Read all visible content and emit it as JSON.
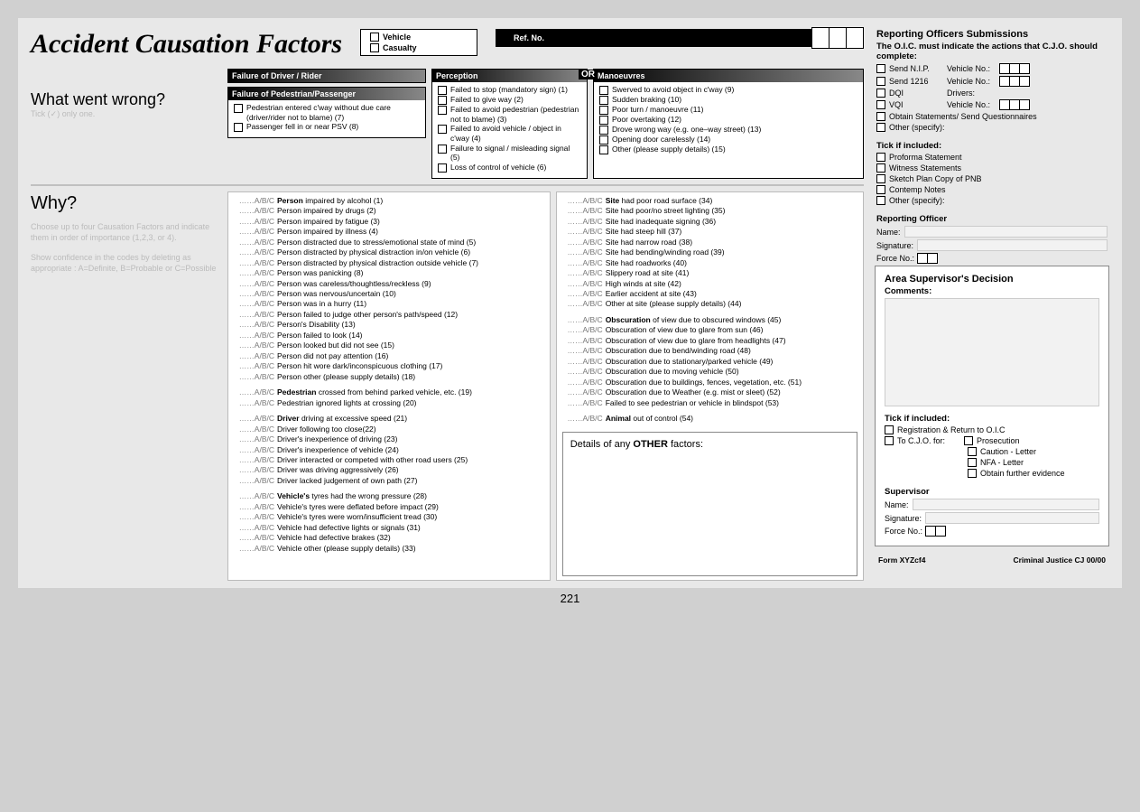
{
  "title": "Accident Causation Factors",
  "vehicle_label": "Vehicle",
  "casualty_label": "Casualty",
  "ref_label": "Ref. No.",
  "page_number": "221",
  "wwwrong": {
    "heading": "What went wrong?",
    "sub": "Tick (✓) only one.",
    "driver_hdr": "Failure of Driver / Rider",
    "ped_hdr": "Failure of Pedestrian/Passenger",
    "ped_items": [
      "Pedestrian entered c'way without due care (driver/rider not to blame) (7)",
      "Passenger fell in or near PSV (8)"
    ],
    "perc_hdr": "Perception",
    "perc_items": [
      "Failed to stop (mandatory sign) (1)",
      "Failed to give way (2)",
      "Failed to avoid pedestrian (pedestrian not to blame) (3)",
      "Failed to avoid vehicle / object in c'way (4)",
      "Failure to signal / misleading signal (5)",
      "Loss of control of vehicle (6)"
    ],
    "or_label": "OR",
    "man_hdr": "Manoeuvres",
    "man_items": [
      "Swerved to avoid object in c'way (9)",
      "Sudden braking (10)",
      "Poor turn / manoeuvre (11)",
      "Poor overtaking (12)",
      "Drove wrong way (e.g. one–way street) (13)",
      "Opening door carelessly (14)",
      "Other (please supply details) (15)"
    ]
  },
  "why": {
    "heading": "Why?",
    "side_p1": "Choose up to four Causation Factors and indicate them in order of importance (1,2,3, or 4).",
    "side_p2": "Show confidence in the codes by deleting as appropriate : A=Definite, B=Probable or C=Possible",
    "abc": "……A/B/C",
    "left_items": [
      {
        "t": "Person impaired by alcohol (1)",
        "b": true
      },
      {
        "t": "Person impaired by drugs (2)"
      },
      {
        "t": "Person impaired by fatigue (3)"
      },
      {
        "t": "Person impaired by illness (4)"
      },
      {
        "t": "Person distracted due to stress/emotional state of mind (5)"
      },
      {
        "t": "Person distracted by physical distraction in/on vehicle (6)"
      },
      {
        "t": "Person distracted by physical distraction outside vehicle (7)"
      },
      {
        "t": "Person was panicking (8)"
      },
      {
        "t": "Person was careless/thoughtless/reckless (9)"
      },
      {
        "t": "Person was nervous/uncertain (10)"
      },
      {
        "t": "Person was in a hurry (11)"
      },
      {
        "t": "Person failed to judge other person's path/speed (12)"
      },
      {
        "t": "Person's Disability (13)"
      },
      {
        "t": "Person failed to look (14)"
      },
      {
        "t": "Person looked but did not see (15)"
      },
      {
        "t": "Person did not pay attention (16)"
      },
      {
        "t": "Person hit wore dark/inconspicuous clothing (17)"
      },
      {
        "t": "Person other (please supply details) (18)"
      },
      {
        "gap": true
      },
      {
        "t": "Pedestrian crossed from behind parked vehicle, etc. (19)",
        "b": true
      },
      {
        "t": "Pedestrian ignored lights at crossing (20)"
      },
      {
        "gap": true
      },
      {
        "t": "Driver driving at excessive speed (21)",
        "b": true
      },
      {
        "t": "Driver following too close(22)"
      },
      {
        "t": "Driver's  inexperience of driving (23)"
      },
      {
        "t": "Driver's  inexperience of vehicle (24)"
      },
      {
        "t": "Driver interacted or competed with other road users (25)"
      },
      {
        "t": "Driver was driving aggressively (26)"
      },
      {
        "t": "Driver lacked judgement of own path (27)"
      },
      {
        "gap": true
      },
      {
        "t": "Vehicle's tyres had the wrong pressure (28)",
        "b": true
      },
      {
        "t": "Vehicle's tyres were deflated before impact (29)"
      },
      {
        "t": "Vehicle's tyres were worn/insufficient tread (30)"
      },
      {
        "t": "Vehicle had defective lights or signals (31)"
      },
      {
        "t": "Vehicle had defective brakes (32)"
      },
      {
        "t": "Vehicle other (please supply details) (33)"
      }
    ],
    "right_items": [
      {
        "t": "Site had poor road surface (34)",
        "b": true
      },
      {
        "t": "Site had poor/no street lighting (35)"
      },
      {
        "t": "Site had inadequate signing (36)"
      },
      {
        "t": "Site had steep hill (37)"
      },
      {
        "t": "Site had narrow road (38)"
      },
      {
        "t": "Site had bending/winding road (39)"
      },
      {
        "t": "Site had roadworks (40)"
      },
      {
        "t": "Slippery road at site (41)"
      },
      {
        "t": "High winds at site (42)"
      },
      {
        "t": "Earlier accident at site (43)"
      },
      {
        "t": "Other at site (please supply details) (44)"
      },
      {
        "gap": true
      },
      {
        "t": "Obscuration of view due to obscured windows  (45)",
        "b": true
      },
      {
        "t": "Obscuration of view due to glare from sun (46)"
      },
      {
        "t": "Obscuration of view due to glare from headlights (47)"
      },
      {
        "t": "Obscuration due to bend/winding road (48)"
      },
      {
        "t": "Obscuration due to stationary/parked vehicle (49)"
      },
      {
        "t": "Obscuration due to moving vehicle (50)"
      },
      {
        "t": "Obscuration due to buildings, fences, vegetation, etc. (51)"
      },
      {
        "t": "Obscuration due to Weather (e.g. mist or sleet) (52)"
      },
      {
        "t": "Failed to see pedestrian or vehicle in blindspot (53)"
      },
      {
        "gap": true
      },
      {
        "t": "Animal out of control (54)",
        "b": true
      }
    ],
    "details_label": "Details of any OTHER factors:"
  },
  "right": {
    "submissions_hdr": "Reporting Officers Submissions",
    "submissions_sub": "The O.I.C. must indicate the actions that C.J.O. should complete:",
    "send_nip": "Send N.I.P.",
    "send_1216": "Send 1216",
    "vehicle_no": "Vehicle No.:",
    "dqi": "DQI",
    "drivers": "Drivers:",
    "vqi": "VQI",
    "obtain_stmt": "Obtain Statements/ Send Questionnaires",
    "other_spec": "Other (specify):",
    "tick_hdr": "Tick if included:",
    "tick_items": [
      "Proforma Statement",
      "Witness Statements",
      "Sketch Plan Copy of PNB",
      "Contemp Notes",
      "Other (specify):"
    ],
    "rep_off_hdr": "Reporting Officer",
    "name": "Name:",
    "signature": "Signature:",
    "force_no": "Force No.:",
    "area_hdr": "Area Supervisor's Decision",
    "comments": "Comments:",
    "tick2_items": {
      "reg": "Registration & Return to O.I.C",
      "tocjo": "To C.J.O. for:",
      "pros": "Prosecution",
      "caution": "Caution - Letter",
      "nfa": "NFA - Letter",
      "obt": "Obtain further evidence"
    },
    "sup_hdr": "Supervisor",
    "form_no": "Form XYZcf4",
    "cj": "Criminal Justice CJ 00/00"
  }
}
